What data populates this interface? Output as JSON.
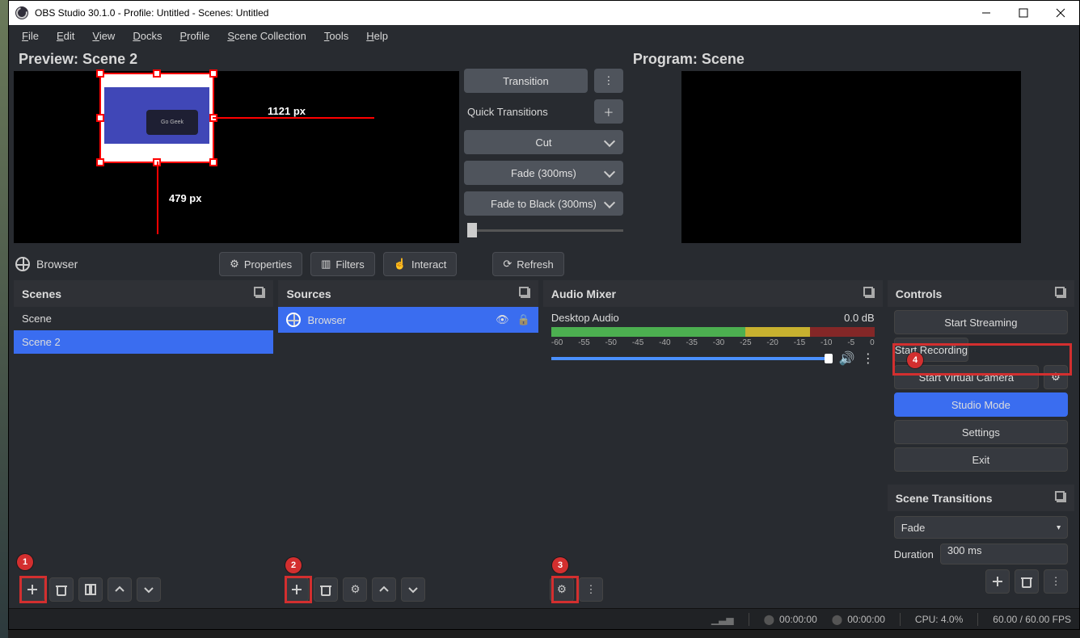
{
  "window_title": "OBS Studio 30.1.0 - Profile: Untitled - Scenes: Untitled",
  "menu": {
    "file": "File",
    "edit": "Edit",
    "view": "View",
    "docks": "Docks",
    "profile": "Profile",
    "scene_collection": "Scene Collection",
    "tools": "Tools",
    "help": "Help"
  },
  "preview": {
    "title": "Preview: Scene 2",
    "dim_w": "1121 px",
    "dim_h": "479 px",
    "source_thumb_label": "Go Geek"
  },
  "center": {
    "transition_btn": "Transition",
    "quick_label": "Quick Transitions",
    "cut": "Cut",
    "fade": "Fade (300ms)",
    "fade_black": "Fade to Black (300ms)"
  },
  "program": {
    "title": "Program: Scene"
  },
  "toolbar": {
    "selected_source": "Browser",
    "properties": "Properties",
    "filters": "Filters",
    "interact": "Interact",
    "refresh": "Refresh"
  },
  "scenes_panel": {
    "title": "Scenes",
    "items": [
      "Scene",
      "Scene 2"
    ],
    "selected_index": 1
  },
  "sources_panel": {
    "title": "Sources",
    "items": [
      {
        "name": "Browser",
        "selected": true
      }
    ]
  },
  "audio_panel": {
    "title": "Audio Mixer",
    "sources": [
      {
        "name": "Desktop Audio",
        "level": "0.0 dB"
      }
    ],
    "ticks": [
      "-60",
      "-55",
      "-50",
      "-45",
      "-40",
      "-35",
      "-30",
      "-25",
      "-20",
      "-15",
      "-10",
      "-5",
      "0"
    ]
  },
  "controls_panel": {
    "title": "Controls",
    "start_streaming": "Start Streaming",
    "start_recording": "Start Recording",
    "start_vcam": "Start Virtual Camera",
    "studio_mode": "Studio Mode",
    "settings": "Settings",
    "exit": "Exit"
  },
  "transitions_panel": {
    "title": "Scene Transitions",
    "selected": "Fade",
    "duration_label": "Duration",
    "duration_value": "300 ms"
  },
  "status": {
    "rec1": "00:00:00",
    "rec2": "00:00:00",
    "cpu": "CPU: 4.0%",
    "fps": "60.00 / 60.00 FPS"
  },
  "annotations": {
    "1": "1",
    "2": "2",
    "3": "3",
    "4": "4"
  }
}
